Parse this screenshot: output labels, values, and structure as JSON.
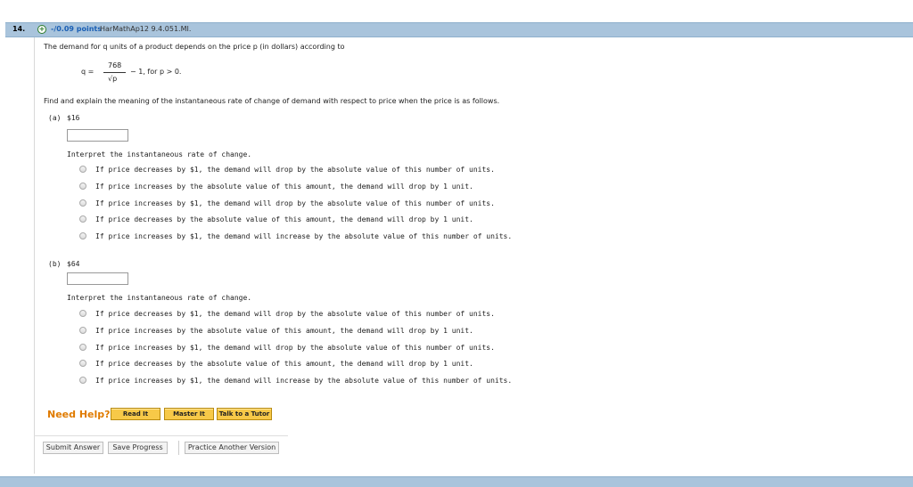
{
  "question": {
    "number": "14.",
    "points": "-/0.09 points",
    "code": "HarMathAp12 9.4.051.MI."
  },
  "prompt": {
    "intro": "The demand for q units of a product depends on the price p (in dollars) according to",
    "eq_left": "q =",
    "numerator": "768",
    "denominator": "√p",
    "eq_right": "− 1,  for p > 0.",
    "instruction": "Find and explain the meaning of the instantaneous rate of change of demand with respect to price when the price is as follows."
  },
  "parts": [
    {
      "label": "(a)",
      "value": "$16",
      "answer": "",
      "interpret": "Interpret the instantaneous rate of change.",
      "options": [
        "If price decreases by $1, the demand will drop by the absolute value of this number of units.",
        "If price increases by the absolute value of this amount, the demand will drop by 1 unit.",
        "If price increases by $1, the demand will drop by the absolute value of this number of units.",
        "If price decreases by the absolute value of this amount, the demand will drop by 1 unit.",
        "If price increases by $1, the demand will increase by the absolute value of this number of units."
      ]
    },
    {
      "label": "(b)",
      "value": "$64",
      "answer": "",
      "interpret": "Interpret the instantaneous rate of change.",
      "options": [
        "If price decreases by $1, the demand will drop by the absolute value of this number of units.",
        "If price increases by the absolute value of this amount, the demand will drop by 1 unit.",
        "If price increases by $1, the demand will drop by the absolute value of this number of units.",
        "If price decreases by the absolute value of this amount, the demand will drop by 1 unit.",
        "If price increases by $1, the demand will increase by the absolute value of this number of units."
      ]
    }
  ],
  "help": {
    "label": "Need Help?",
    "read": "Read It",
    "master": "Master It",
    "tutor": "Talk to a Tutor"
  },
  "actions": {
    "submit": "Submit Answer",
    "save": "Save Progress",
    "practice": "Practice Another Version"
  },
  "colors": {
    "header_bar": "#a9c4dc",
    "points": "#1a5fb4",
    "help": "#e07b00",
    "help_button": "#f7c948"
  }
}
